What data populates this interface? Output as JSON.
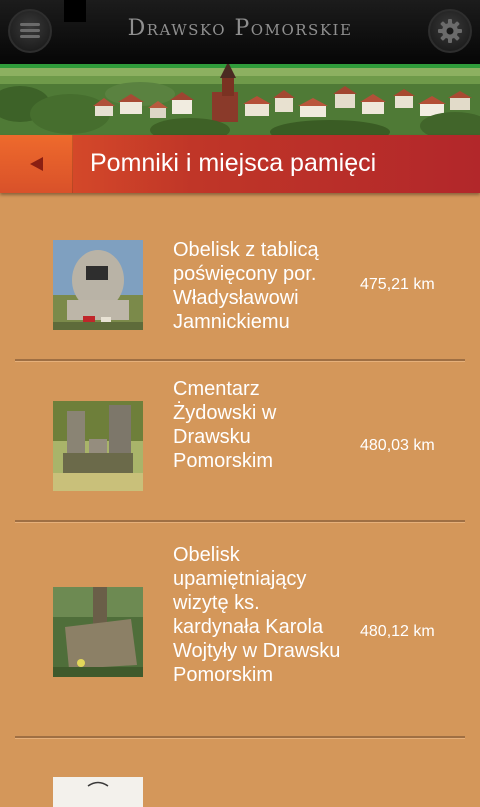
{
  "app": {
    "title": "Drawsko Pomorskie"
  },
  "header": {
    "menu_icon": "menu-icon",
    "settings_icon": "gear-icon",
    "back_icon": "back-arrow-icon"
  },
  "section": {
    "title": "Pomniki i miejsca pamięci"
  },
  "items": [
    {
      "title": "Obelisk z tablicą poświęcony por. Władysławowi Jamnickiemu",
      "distance": "475,21 km"
    },
    {
      "title": "Cmentarz Żydowski w Drawsku Pomorskim",
      "distance": "480,03 km"
    },
    {
      "title": "Obelisk upamiętniający wizytę ks. kardynała Karola Wojtyły w Drawsku Pomorskim",
      "distance": "480,12 km"
    }
  ],
  "colors": {
    "header_red": "#c03628",
    "back_orange": "#e85a2b",
    "background": "#d4975a"
  }
}
